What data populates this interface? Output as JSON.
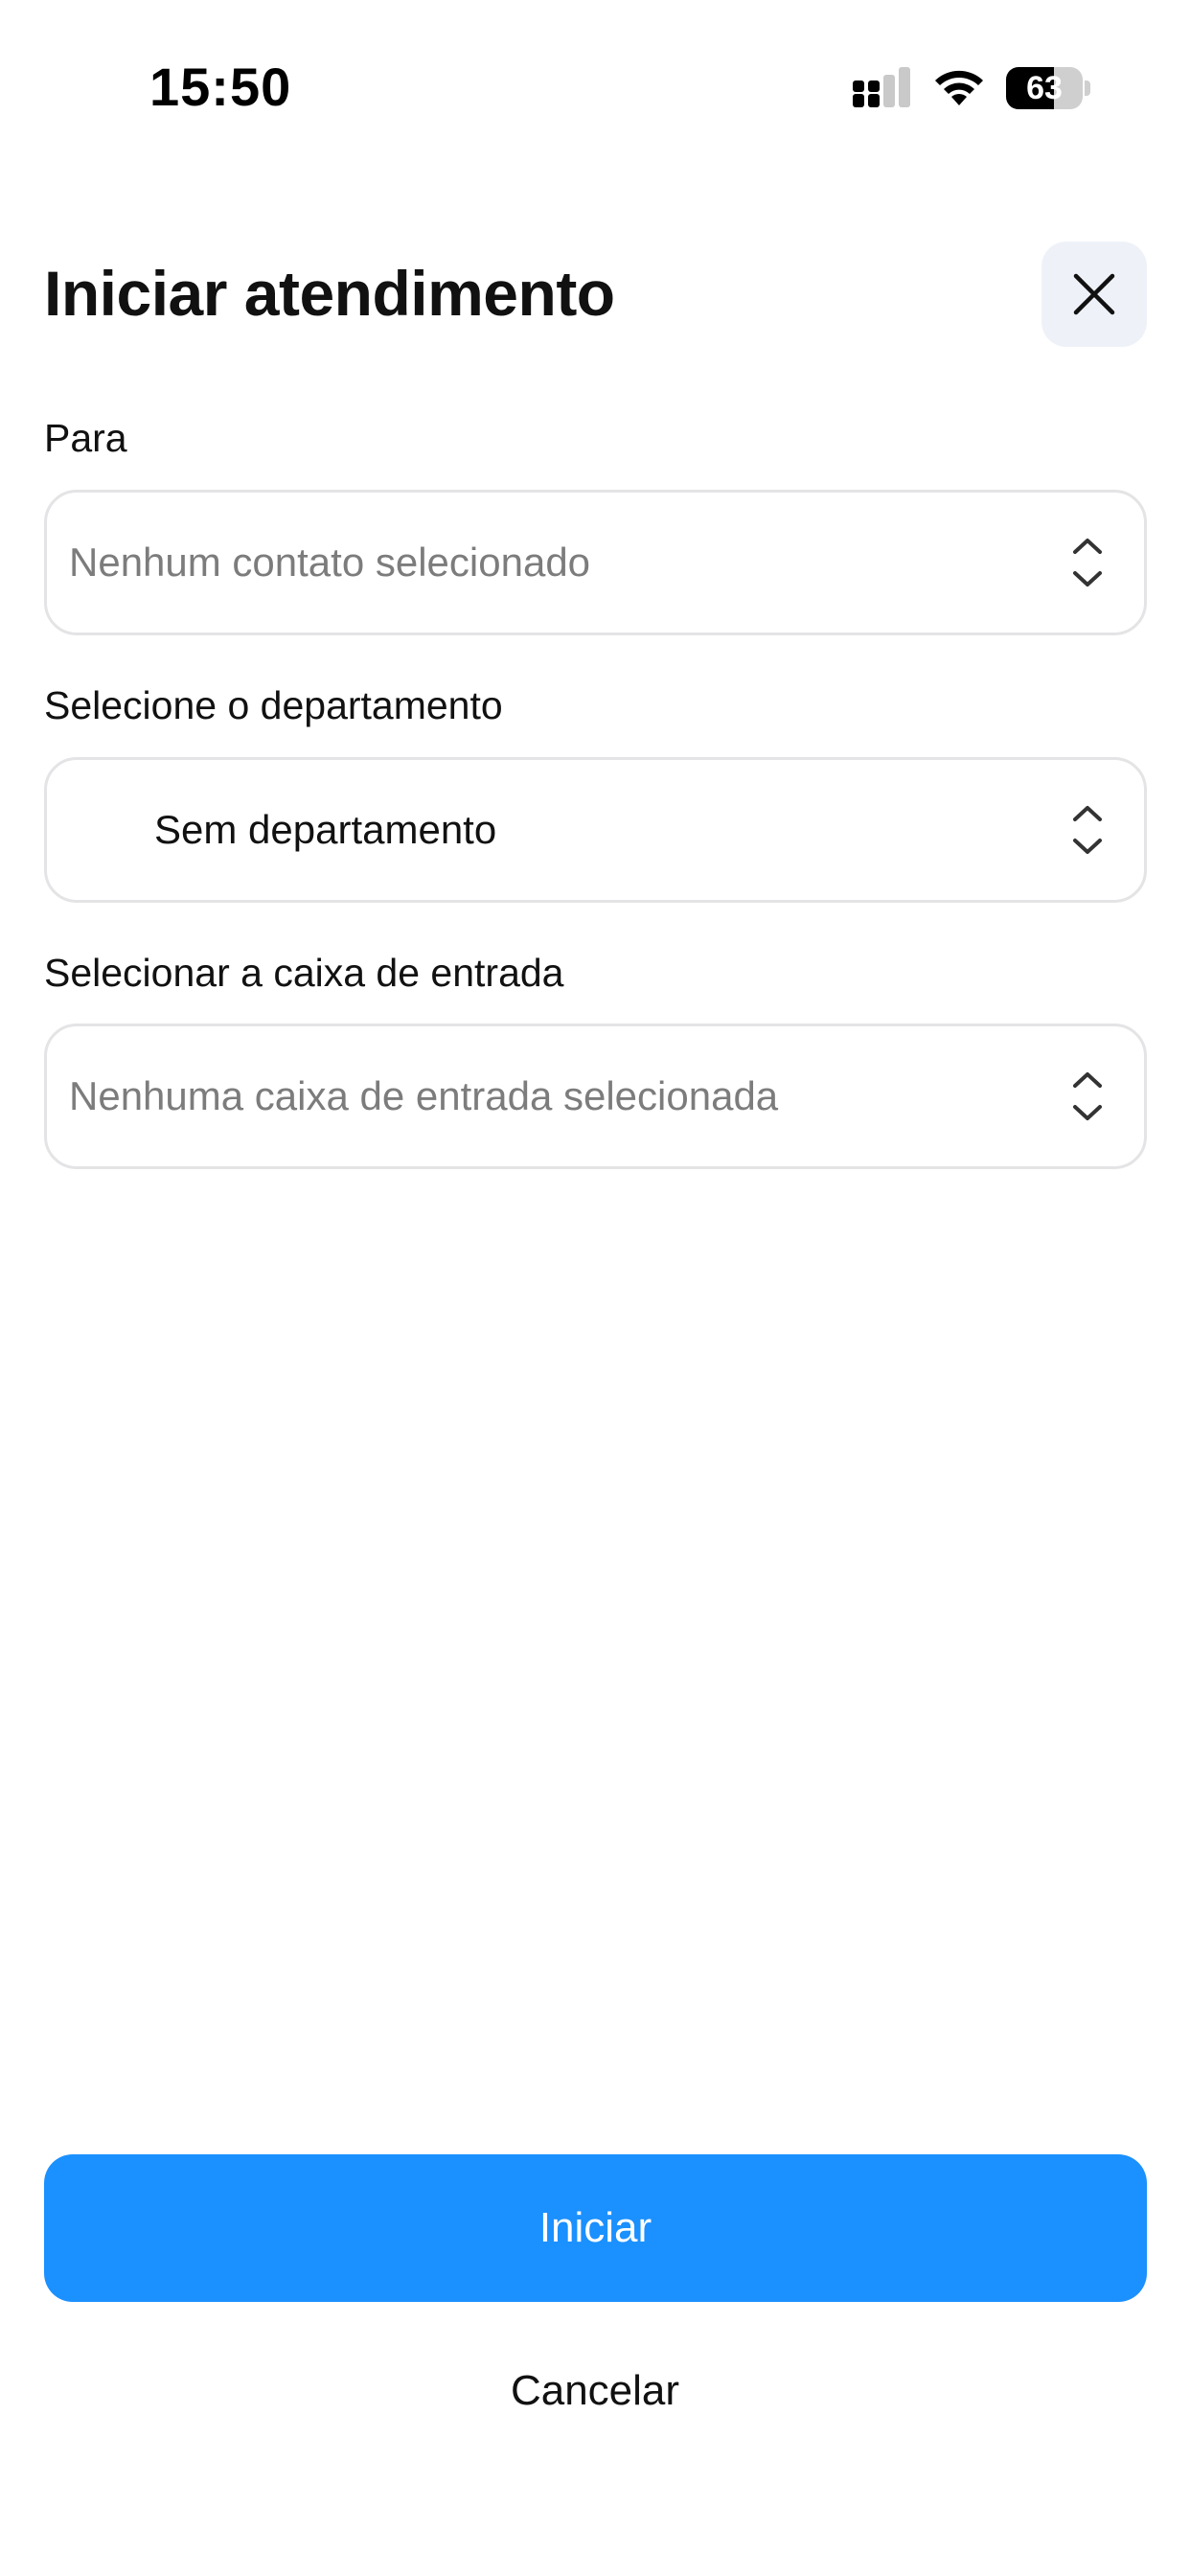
{
  "status_bar": {
    "time": "15:50",
    "battery_level": "63",
    "battery_fraction": 0.63,
    "icons": [
      "signal-icon",
      "wifi-icon",
      "battery-icon"
    ]
  },
  "header": {
    "title": "Iniciar atendimento",
    "close_icon": "close-icon"
  },
  "form": {
    "contact": {
      "label": "Para",
      "placeholder": "Nenhum contato selecionado"
    },
    "department": {
      "label": "Selecione o departamento",
      "value": "Sem departamento"
    },
    "inbox": {
      "label": "Selecionar a caixa de entrada",
      "placeholder": "Nenhuma caixa de entrada selecionada"
    },
    "select_icon": "chevron-up-down-icon"
  },
  "actions": {
    "start_label": "Iniciar",
    "cancel_label": "Cancelar"
  },
  "colors": {
    "primary": "#1b90ff",
    "close_button_bg": "#eef2f8",
    "placeholder_text": "#7c7c7c",
    "field_border": "#e4e4e6"
  }
}
